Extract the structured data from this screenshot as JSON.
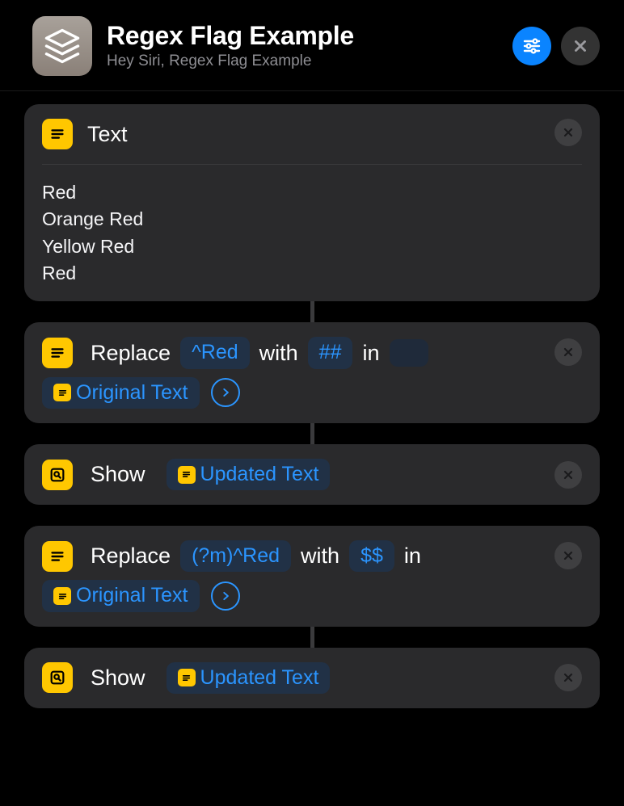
{
  "header": {
    "title": "Regex Flag Example",
    "subtitle": "Hey Siri, Regex Flag Example"
  },
  "actions": {
    "text": {
      "label": "Text",
      "body": "Red\nOrange Red\nYellow Red\nRed"
    },
    "replace1": {
      "verb": "Replace",
      "pattern": "^Red",
      "with_word": "with",
      "replacement": "##",
      "in_word": "in",
      "source_label": "Original Text"
    },
    "show1": {
      "verb": "Show",
      "target_label": "Updated Text"
    },
    "replace2": {
      "verb": "Replace",
      "pattern": "(?m)^Red",
      "with_word": "with",
      "replacement": "$$",
      "in_word": "in",
      "source_label": "Original Text"
    },
    "show2": {
      "verb": "Show",
      "target_label": "Updated Text"
    }
  }
}
